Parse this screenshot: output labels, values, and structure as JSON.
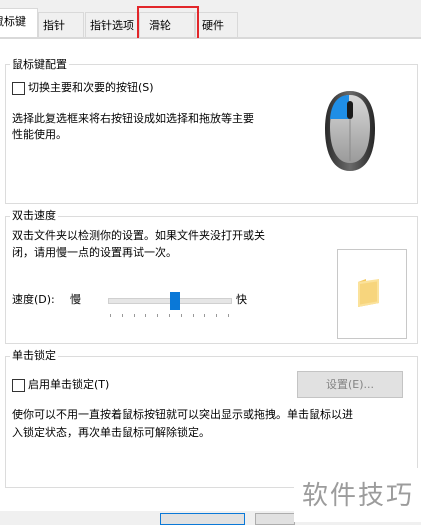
{
  "tabs": [
    {
      "label": "鼠标键",
      "active": true
    },
    {
      "label": "指针",
      "active": false
    },
    {
      "label": "指针选项",
      "active": false
    },
    {
      "label": "滑轮",
      "active": false
    },
    {
      "label": "硬件",
      "active": false
    }
  ],
  "buttons_group": {
    "title": "鼠标键配置",
    "switch_label": "切换主要和次要的按钮(S)",
    "switch_checked": false,
    "desc_line1": "选择此复选框来将右按钮设成如选择和拖放等主要",
    "desc_line2": "性能使用。"
  },
  "double_click": {
    "title": "双击速度",
    "desc_line1": "双击文件夹以检测你的设置。如果文件夹没打开或关",
    "desc_line2": "闭，请用慢一点的设置再试一次。",
    "speed_label": "速度(D):",
    "slow_label": "慢",
    "fast_label": "快",
    "speed_level": 0.55
  },
  "click_lock": {
    "title": "单击锁定",
    "enable_label": "启用单击锁定(T)",
    "enable_checked": false,
    "settings_button": "设置(E)...",
    "desc_line1": "使你可以不用一直按着鼠标按钮就可以突出显示或拖拽。单击鼠标以进",
    "desc_line2": "入锁定状态，再次单击鼠标可解除锁定。"
  },
  "watermark": "软件技巧",
  "colors": {
    "accent": "#0a78d7",
    "highlight": "#e2262a"
  }
}
